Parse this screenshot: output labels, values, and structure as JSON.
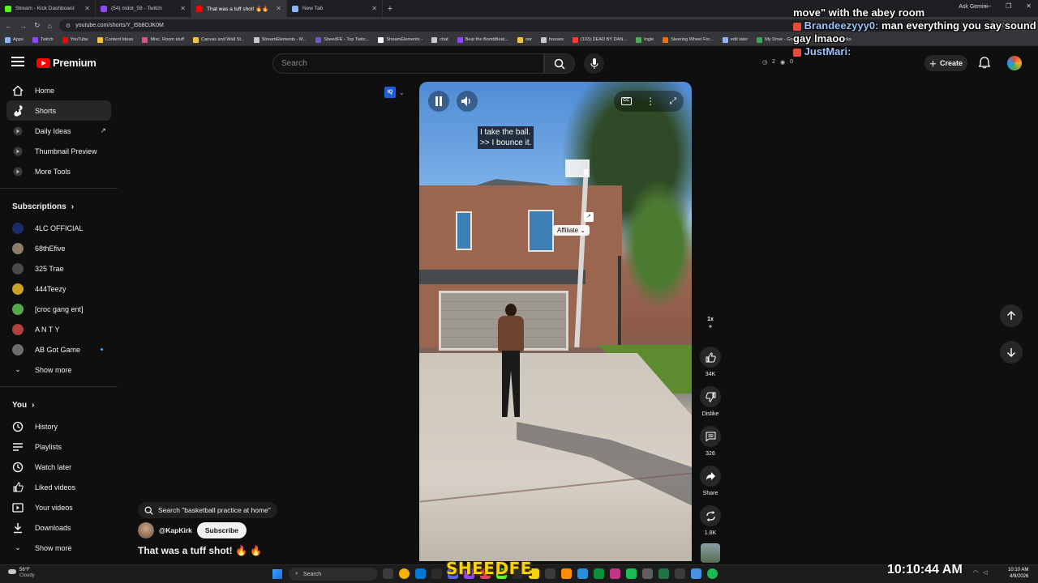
{
  "browser": {
    "tabs": [
      {
        "label": "Stream - Kick Dashboard",
        "color": "#53fc18",
        "active": false
      },
      {
        "label": "(54) mdot_59 - Twitch",
        "color": "#9146ff",
        "active": false
      },
      {
        "label": "That was a tuff shot! 🔥🔥",
        "color": "#ff0000",
        "active": true
      },
      {
        "label": "New Tab",
        "color": "#8ab4f8",
        "active": false
      }
    ],
    "gemini_label": "Ask Gemini",
    "url": "youtube.com/shorts/Y_t5b8OJK0M",
    "bookmarks": [
      "Apps",
      "Twitch",
      "YouTube",
      "Content Ideas",
      "Misc. Room stuff",
      "Canvas and Wall St...",
      "StreamElements - M...",
      "SheedFE - Top Twitc...",
      "StreamElements -",
      "chat",
      "Beat the BombBeat...",
      "oor",
      "houses",
      "(103) DEAD BY DAN...",
      "Ingle",
      "Steering Wheel For...",
      "edit later",
      "My Drive - Google...",
      "All Bookmarks"
    ]
  },
  "masthead": {
    "logo_text": "Premium",
    "search_placeholder": "Search",
    "create_label": "Create",
    "stat_a": "2",
    "stat_b": "0"
  },
  "chat_overlay": {
    "line1": "move\" with the abey room",
    "user2": "Brandeezyyy0:",
    "msg2": "man everything you say sound gay lmaoo",
    "user3": "JustMari:"
  },
  "sidebar": {
    "main": [
      {
        "label": "Home",
        "icon": "home-icon",
        "active": false
      },
      {
        "label": "Shorts",
        "icon": "shorts-icon",
        "active": true
      },
      {
        "label": "Daily Ideas",
        "icon": "app-icon",
        "active": false
      },
      {
        "label": "Thumbnail Preview",
        "icon": "app-icon",
        "active": false
      },
      {
        "label": "More Tools",
        "icon": "app-icon",
        "active": false
      }
    ],
    "subscriptions_heading": "Subscriptions",
    "subscriptions": [
      {
        "label": "4LC OFFICIAL",
        "color": "#1b2a6b"
      },
      {
        "label": "68thEfive",
        "color": "#8c7d6a"
      },
      {
        "label": "325 Trae",
        "color": "#4a4a4a"
      },
      {
        "label": "444Teezy",
        "color": "#c9a227"
      },
      {
        "label": "[croc gang ent]",
        "color": "#55a84b"
      },
      {
        "label": "A N T Y",
        "color": "#b0413e"
      },
      {
        "label": "AB Got Game",
        "color": "#6d6d6d"
      }
    ],
    "show_more": "Show more",
    "you_heading": "You",
    "you_items": [
      {
        "label": "History",
        "icon": "history-icon"
      },
      {
        "label": "Playlists",
        "icon": "playlists-icon"
      },
      {
        "label": "Watch later",
        "icon": "watch-later-icon"
      },
      {
        "label": "Liked videos",
        "icon": "like-icon"
      },
      {
        "label": "Your videos",
        "icon": "your-videos-icon"
      },
      {
        "label": "Downloads",
        "icon": "download-icon"
      }
    ],
    "show_more_2": "Show more"
  },
  "video": {
    "caption_line1": "I take the ball.",
    "caption_line2": ">> I bounce it.",
    "affiliate": "Affiliate",
    "speed": "1x"
  },
  "actions": {
    "likes": "34K",
    "dislike": "Dislike",
    "comments": "326",
    "share": "Share",
    "remix": "1.8K"
  },
  "info": {
    "search_suggestion": "Search \"basketball practice at home\"",
    "channel": "@KapKirk",
    "subscribe": "Subscribe",
    "title": "That was a tuff shot! 🔥 🔥"
  },
  "taskbar": {
    "temp": "56°F",
    "condition": "Cloudy",
    "search": "Search",
    "overlay_text": "SHEEDFE",
    "stream_clock": "10:10:44 AM",
    "time": "10:10 AM",
    "date": "4/9/2026"
  }
}
